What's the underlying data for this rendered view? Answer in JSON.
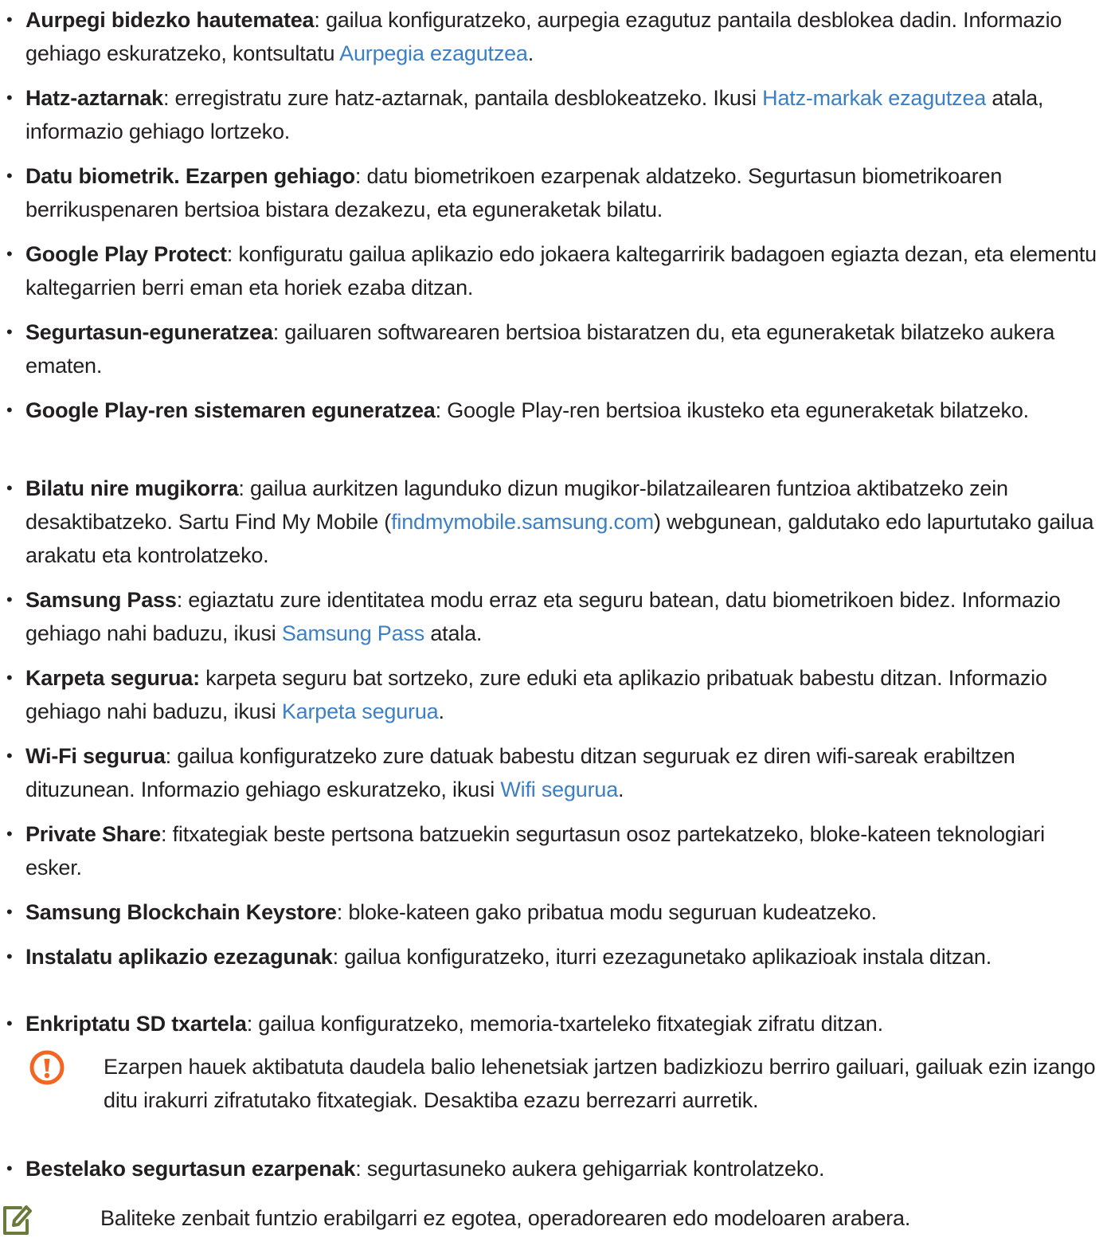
{
  "items": [
    {
      "term": "Aurpegi bidezko hautematea",
      "a": ": gailua konfiguratzeko, aurpegia ezagutuz pantaila desblokea dadin. Informazio gehiago eskuratzeko, kontsultatu ",
      "link": "Aurpegia ezagutzea",
      "b": "."
    },
    {
      "term": "Hatz-aztarnak",
      "a": ": erregistratu zure hatz-aztarnak, pantaila desblokeatzeko. Ikusi ",
      "link": "Hatz-markak ezagutzea",
      "b": " atala, informazio gehiago lortzeko."
    },
    {
      "term": "Datu biometrik. Ezarpen gehiago",
      "a": ": datu biometrikoen ezarpenak aldatzeko. Segurtasun biometrikoaren berrikuspenaren bertsioa bistara dezakezu, eta eguneraketak bilatu."
    },
    {
      "term": "Google Play Protect",
      "a": ": konfiguratu gailua aplikazio edo jokaera kaltegarririk badagoen egiazta dezan, eta elementu kaltegarrien berri eman eta horiek ezaba ditzan."
    },
    {
      "term": "Segurtasun-eguneratzea",
      "a": ": gailuaren softwarearen bertsioa bistaratzen du, eta eguneraketak bilatzeko aukera ematen."
    },
    {
      "term": "Google Play-ren sistemaren eguneratzea",
      "a": ": Google Play-ren bertsioa ikusteko eta eguneraketak bilatzeko."
    },
    {
      "term": "Bilatu nire mugikorra",
      "a": ": gailua aurkitzen lagunduko dizun mugikor-bilatzailearen funtzioa aktibatzeko zein desaktibatzeko. Sartu Find My Mobile (",
      "link": "findmymobile.samsung.com",
      "b": ") webgunean, galdutako edo lapurtutako gailua arakatu eta kontrolatzeko."
    },
    {
      "term": "Samsung Pass",
      "a": ": egiaztatu zure identitatea modu erraz eta seguru batean, datu biometrikoen bidez. Informazio gehiago nahi baduzu, ikusi ",
      "link": "Samsung Pass",
      "b": " atala."
    },
    {
      "term": "Karpeta segurua:",
      "a": " karpeta seguru bat sortzeko, zure eduki eta aplikazio pribatuak babestu ditzan. Informazio gehiago nahi baduzu, ikusi ",
      "link": "Karpeta segurua",
      "b": "."
    },
    {
      "term": "Wi-Fi segurua",
      "a": ": gailua konfiguratzeko zure datuak babestu ditzan seguruak ez diren wifi-sareak erabiltzen dituzunean. Informazio gehiago eskuratzeko, ikusi ",
      "link": "Wifi segurua",
      "b": "."
    },
    {
      "term": "Private Share",
      "a": ": fitxategiak beste pertsona batzuekin segurtasun osoz partekatzeko, bloke-kateen teknologiari esker."
    },
    {
      "term": "Samsung Blockchain Keystore",
      "a": ": bloke-kateen gako pribatua modu seguruan kudeatzeko."
    },
    {
      "term": "Instalatu aplikazio ezezagunak",
      "a": ": gailua konfiguratzeko, iturri ezezagunetako aplikazioak instala ditzan."
    },
    {
      "term": "Enkriptatu SD txartela",
      "a": ": gailua konfiguratzeko, memoria-txarteleko fitxategiak zifratu ditzan."
    },
    {
      "term": "Bestelako segurtasun ezarpenak",
      "a": ": segurtasuneko aukera gehigarriak kontrolatzeko."
    }
  ],
  "caution_note": "Ezarpen hauek aktibatuta daudela balio lehenetsiak jartzen badizkiozu berriro gailuari, gailuak ezin izango ditu irakurri zifratutako fitxategiak. Desaktiba ezazu berrezarri aurretik.",
  "footer_note": "Baliteke zenbait funtzio erabilgarri ez egotea, operadorearen edo modeloaren arabera.",
  "colors": {
    "link": "#3b7fc4",
    "caution": "#f26522",
    "text": "#231f20"
  },
  "icons": {
    "caution": "caution-icon",
    "note": "pen-icon"
  }
}
